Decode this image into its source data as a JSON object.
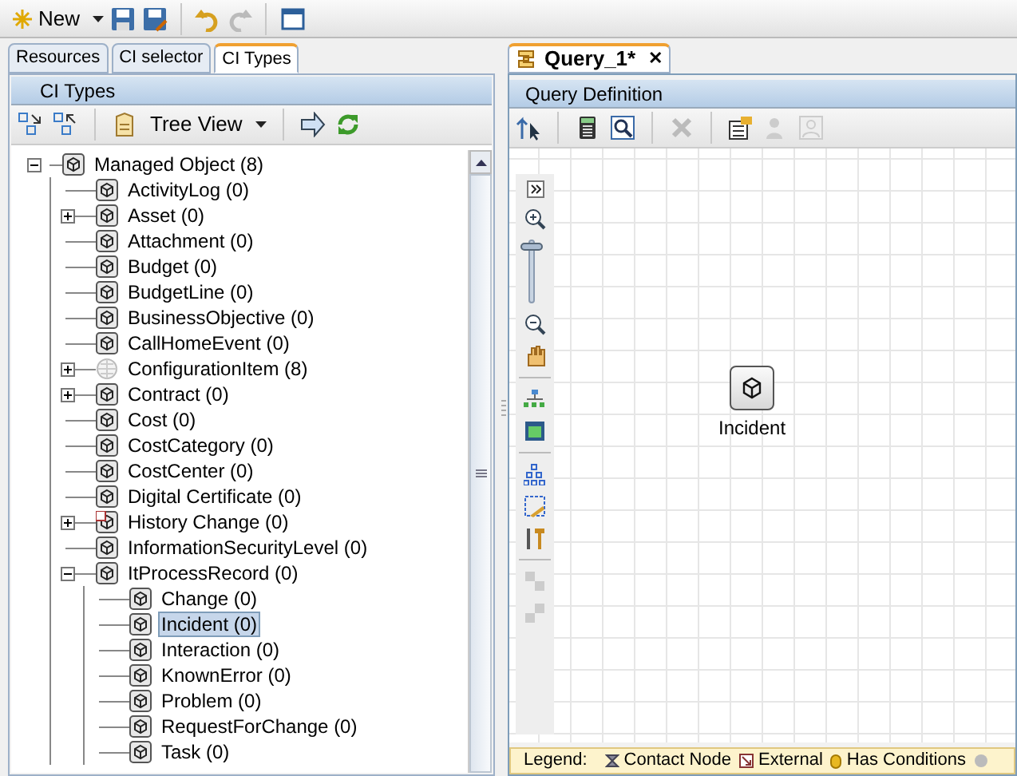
{
  "toolbar": {
    "new_label": "New"
  },
  "left_tabs": [
    {
      "label": "Resources",
      "selected": false
    },
    {
      "label": "CI selector",
      "selected": false
    },
    {
      "label": "CI Types",
      "selected": true
    }
  ],
  "ci_panel": {
    "title": "CI Types",
    "view_label": "Tree View"
  },
  "tree": [
    {
      "label": "Managed Object (8)",
      "kind": "ci",
      "expanded": true,
      "selected": false,
      "children": [
        {
          "label": "ActivityLog (0)",
          "kind": "ci",
          "selected": false
        },
        {
          "label": "Asset (0)",
          "kind": "ci",
          "expanded": false,
          "selected": false
        },
        {
          "label": "Attachment (0)",
          "kind": "ci",
          "selected": false
        },
        {
          "label": "Budget (0)",
          "kind": "ci",
          "selected": false
        },
        {
          "label": "BudgetLine (0)",
          "kind": "ci",
          "selected": false
        },
        {
          "label": "BusinessObjective (0)",
          "kind": "ci",
          "selected": false
        },
        {
          "label": "CallHomeEvent (0)",
          "kind": "ci",
          "selected": false
        },
        {
          "label": "ConfigurationItem (8)",
          "kind": "abstract",
          "expanded": false,
          "selected": false
        },
        {
          "label": "Contract (0)",
          "kind": "ci",
          "expanded": false,
          "selected": false
        },
        {
          "label": "Cost (0)",
          "kind": "ci",
          "selected": false
        },
        {
          "label": "CostCategory (0)",
          "kind": "ci",
          "selected": false
        },
        {
          "label": "CostCenter (0)",
          "kind": "ci",
          "selected": false
        },
        {
          "label": "Digital Certificate (0)",
          "kind": "ci",
          "selected": false
        },
        {
          "label": "History Change (0)",
          "kind": "external",
          "expanded": false,
          "selected": false
        },
        {
          "label": "InformationSecurityLevel (0)",
          "kind": "ci",
          "selected": false
        },
        {
          "label": "ItProcessRecord (0)",
          "kind": "ci",
          "expanded": true,
          "selected": false,
          "children": [
            {
              "label": "Change (0)",
              "kind": "ci",
              "selected": false
            },
            {
              "label": "Incident (0)",
              "kind": "ci",
              "selected": true
            },
            {
              "label": "Interaction (0)",
              "kind": "ci",
              "selected": false
            },
            {
              "label": "KnownError (0)",
              "kind": "ci",
              "selected": false
            },
            {
              "label": "Problem (0)",
              "kind": "ci",
              "selected": false
            },
            {
              "label": "RequestForChange (0)",
              "kind": "ci",
              "selected": false
            },
            {
              "label": "Task (0)",
              "kind": "ci",
              "selected": false
            }
          ]
        }
      ]
    }
  ],
  "query_tab": {
    "label": "Query_1*",
    "close": "✕",
    "selected": true
  },
  "query_panel": {
    "title": "Query Definition"
  },
  "zoom": {
    "level": 0.95
  },
  "canvas_nodes": [
    {
      "label": "Incident"
    }
  ],
  "legend": {
    "title": "Legend:",
    "items": [
      {
        "label": "Contact Node",
        "kind": "contact"
      },
      {
        "label": "External",
        "kind": "external"
      },
      {
        "label": "Has Conditions",
        "kind": "conditions"
      }
    ]
  }
}
